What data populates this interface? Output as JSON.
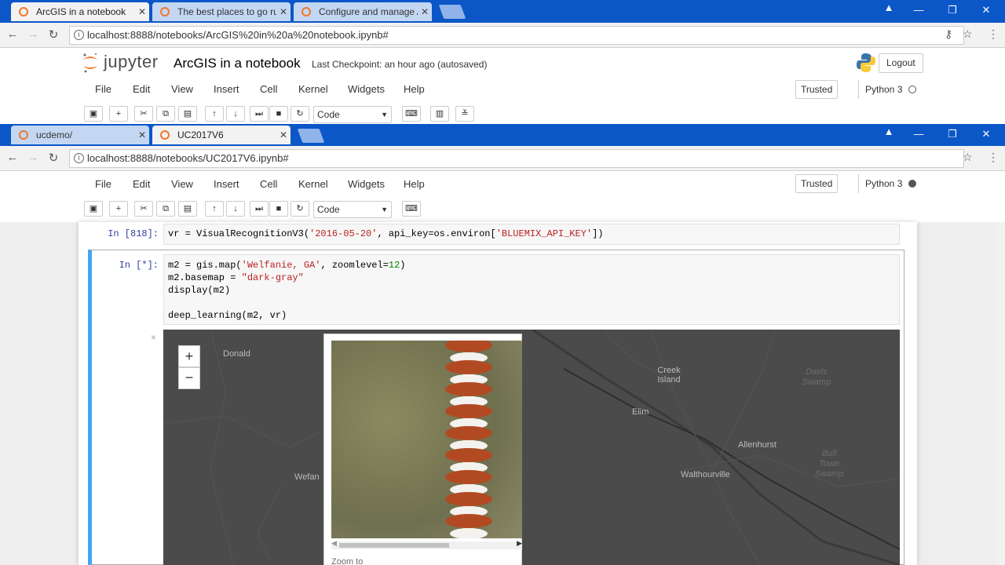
{
  "win1": {
    "tabs": [
      {
        "label": "ArcGIS in a notebook",
        "active": true
      },
      {
        "label": "The best places to go ru",
        "active": false
      },
      {
        "label": "Configure and manage A",
        "active": false
      }
    ],
    "url": "localhost:8888/notebooks/ArcGIS%20in%20a%20notebook.ipynb#",
    "jupyter_logo": "jupyter",
    "notebook_title": "ArcGIS in a notebook",
    "checkpoint": "Last Checkpoint: an hour ago (autosaved)",
    "logout": "Logout",
    "menu": [
      "File",
      "Edit",
      "View",
      "Insert",
      "Cell",
      "Kernel",
      "Widgets",
      "Help"
    ],
    "trusted": "Trusted",
    "kernel": "Python 3",
    "cell_type": "Code"
  },
  "win2": {
    "tabs": [
      {
        "label": "ucdemo/",
        "active": false
      },
      {
        "label": "UC2017V6",
        "active": true
      }
    ],
    "url": "localhost:8888/notebooks/UC2017V6.ipynb#",
    "menu": [
      "File",
      "Edit",
      "View",
      "Insert",
      "Cell",
      "Kernel",
      "Widgets",
      "Help"
    ],
    "trusted": "Trusted",
    "kernel": "Python 3",
    "cell_type": "Code"
  },
  "cells": [
    {
      "prompt": "In [818]:"
    },
    {
      "prompt": "In [*]:"
    }
  ],
  "map": {
    "zoom_in": "+",
    "zoom_out": "−",
    "close": "×",
    "labels": [
      "Donald",
      "Wefan",
      "Creek Island",
      "Elim",
      "Allenhurst",
      "Walthourville"
    ],
    "dim_labels": [
      "Davis Swamp",
      "Bull Town Swamp"
    ],
    "popup_action": "Zoom to"
  },
  "colors": {
    "chrome_blue": "#0b57c8",
    "jupyter_orange": "#f37626",
    "prompt_blue": "#303f9f",
    "cell_selected": "#42a5f5"
  }
}
